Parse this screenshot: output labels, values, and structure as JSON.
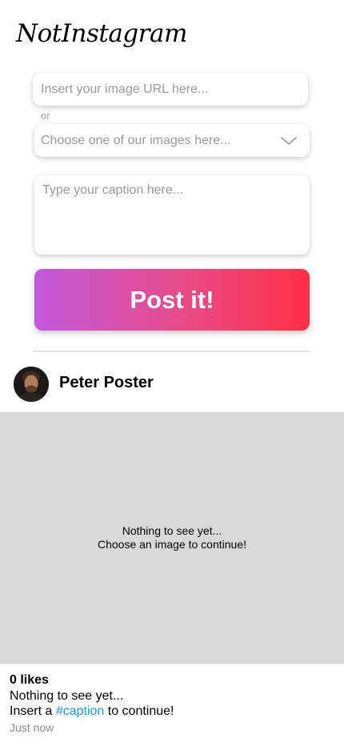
{
  "app": {
    "title": "NotInstagram"
  },
  "form": {
    "url_placeholder": "Insert your image URL here...",
    "or_label": "or",
    "select_placeholder": "Choose one of our images here...",
    "caption_placeholder": "Type your caption here...",
    "post_button_label": "Post it!"
  },
  "post": {
    "author_name": "Peter Poster",
    "image_placeholder_line1": "Nothing to see yet...",
    "image_placeholder_line2": "Choose an image to continue!",
    "likes": "0 likes",
    "caption_line1": "Nothing to see yet...",
    "caption_line2_prefix": "Insert a ",
    "caption_hashtag": "#caption",
    "caption_line2_suffix": " to continue!",
    "timestamp": "Just now"
  },
  "colors": {
    "gradient_start": "#c158dc",
    "gradient_end": "#ff2f45",
    "hashtag": "#1a9ad6",
    "placeholder_bg": "#d9d9d9"
  },
  "icons": {
    "select_chevron": "chevron-down-icon",
    "avatar": "avatar-photo"
  }
}
